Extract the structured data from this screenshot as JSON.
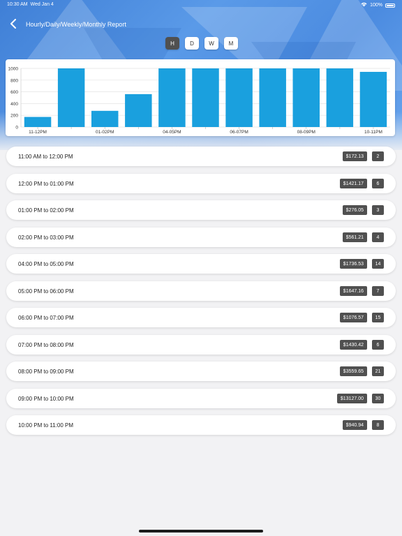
{
  "status_bar": {
    "time": "10:30 AM",
    "date": "Wed Jan 4",
    "battery": "100%"
  },
  "nav": {
    "title": "Hourly/Daily/Weekly/Monthly Report"
  },
  "segments": [
    {
      "label": "H",
      "active": true
    },
    {
      "label": "D",
      "active": false
    },
    {
      "label": "W",
      "active": false
    },
    {
      "label": "M",
      "active": false
    }
  ],
  "colors": {
    "bar": "#1aa0de",
    "badge": "#505050",
    "header": "#4b8be0"
  },
  "chart_data": {
    "type": "bar",
    "categories": [
      "11-12PM",
      "12-01PM",
      "01-02PM",
      "02-03PM",
      "04-05PM",
      "05-06PM",
      "06-07PM",
      "07-08PM",
      "08-09PM",
      "09-10PM",
      "10-11PM"
    ],
    "tick_labels": [
      "11-12PM",
      "",
      "01-02PM",
      "",
      "04-05PM",
      "",
      "06-07PM",
      "",
      "08-09PM",
      "",
      "10-11PM"
    ],
    "values": [
      172.13,
      1000,
      276.05,
      561.21,
      1000,
      1000,
      1000,
      1000,
      1000,
      1000,
      940.94
    ],
    "ylim": [
      0,
      1000
    ],
    "yticks": [
      0,
      200,
      400,
      600,
      800,
      1000
    ],
    "grid": true
  },
  "rows": [
    {
      "label": "11:00 AM to 12:00 PM",
      "amount": "$172.13",
      "count": "2"
    },
    {
      "label": "12:00 PM to 01:00 PM",
      "amount": "$1421.17",
      "count": "6"
    },
    {
      "label": "01:00 PM to 02:00 PM",
      "amount": "$276.05",
      "count": "3"
    },
    {
      "label": "02:00 PM to 03:00 PM",
      "amount": "$561.21",
      "count": "4"
    },
    {
      "label": "04:00 PM to 05:00 PM",
      "amount": "$1736.53",
      "count": "14"
    },
    {
      "label": "05:00 PM to 06:00 PM",
      "amount": "$1647.16",
      "count": "7"
    },
    {
      "label": "06:00 PM to 07:00 PM",
      "amount": "$1076.57",
      "count": "15"
    },
    {
      "label": "07:00 PM to 08:00 PM",
      "amount": "$1430.42",
      "count": "6"
    },
    {
      "label": "08:00 PM to 09:00 PM",
      "amount": "$3559.65",
      "count": "21"
    },
    {
      "label": "09:00 PM to 10:00 PM",
      "amount": "$13127.00",
      "count": "30"
    },
    {
      "label": "10:00 PM to 11:00 PM",
      "amount": "$940.94",
      "count": "8"
    }
  ]
}
